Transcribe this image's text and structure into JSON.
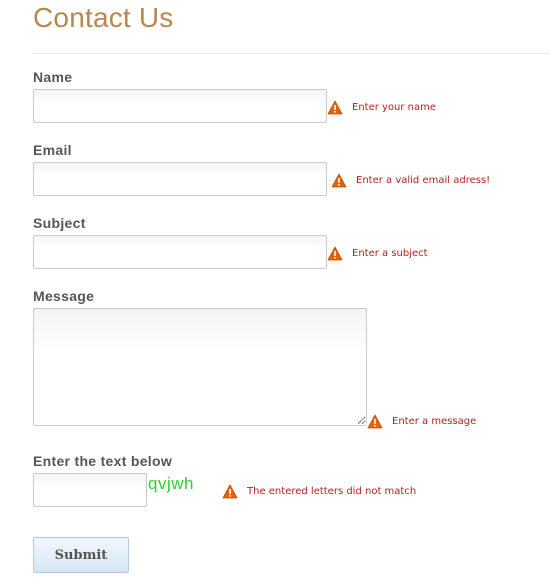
{
  "page": {
    "title": "Contact Us"
  },
  "form": {
    "name": {
      "label": "Name",
      "value": "",
      "error": "Enter your name"
    },
    "email": {
      "label": "Email",
      "value": "",
      "error": "Enter a valid email adress!"
    },
    "subject": {
      "label": "Subject",
      "value": "",
      "error": "Enter a subject"
    },
    "message": {
      "label": "Message",
      "value": "",
      "error": "Enter a message"
    },
    "captcha": {
      "label": "Enter the text below",
      "value": "",
      "code": "qvjwh",
      "error": "The entered letters did not match"
    },
    "submit_label": "Submit"
  },
  "colors": {
    "title": "#b8864f",
    "error_text": "#b22222",
    "warning_icon": "#e8620c",
    "captcha_text": "#33cc33"
  },
  "icons": {
    "warning": "warning-triangle-icon"
  }
}
